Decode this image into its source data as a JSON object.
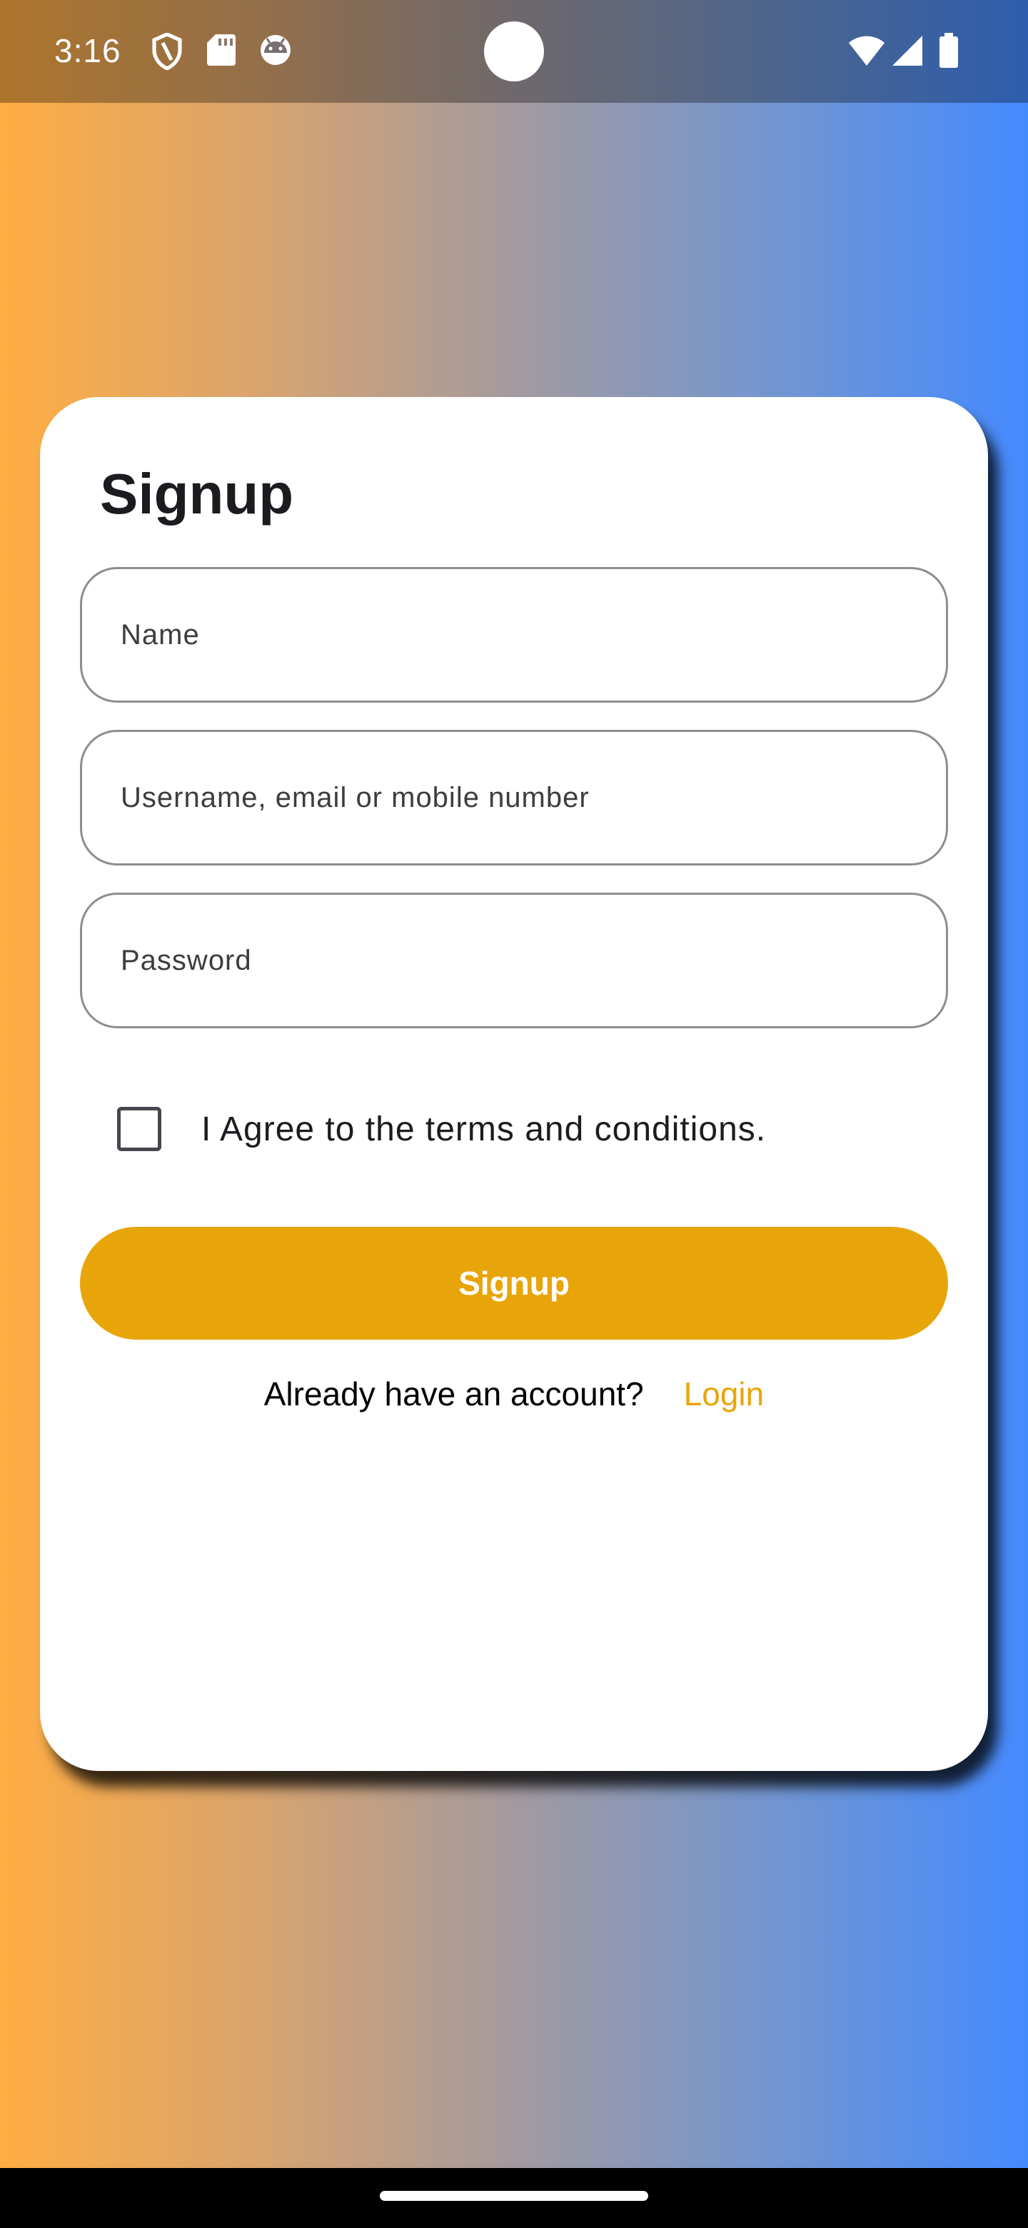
{
  "status_bar": {
    "time": "3:16",
    "left_icons": [
      "shield-icon",
      "sd-card-icon",
      "android-face-icon"
    ],
    "right_icons": [
      "wifi-icon",
      "signal-icon",
      "battery-icon"
    ]
  },
  "background": {
    "gradient_start": "#FFAD42",
    "gradient_end": "#448AFF"
  },
  "form": {
    "title": "Signup",
    "fields": {
      "name": {
        "placeholder": "Name",
        "value": ""
      },
      "username": {
        "placeholder": "Username, email or mobile number",
        "value": ""
      },
      "password": {
        "placeholder": "Password",
        "value": ""
      }
    },
    "terms": {
      "label": "I Agree to the terms and conditions.",
      "checked": false
    },
    "submit_label": "Signup",
    "login_prompt": "Already have an account?",
    "login_link": "Login",
    "accent_color": "#E8A50A"
  }
}
